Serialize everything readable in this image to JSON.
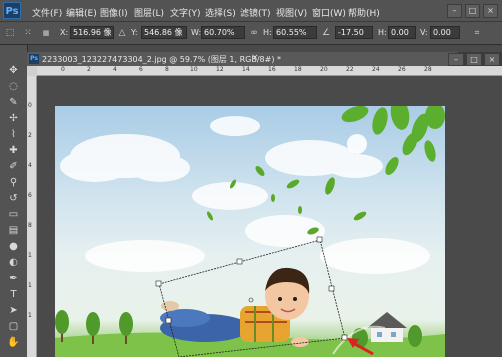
{
  "app": {
    "logo": "Ps"
  },
  "menu": {
    "items": [
      "文件(F)",
      "编辑(E)",
      "图像(I)",
      "图层(L)",
      "文字(Y)",
      "选择(S)",
      "滤镜(T)",
      "视图(V)",
      "窗口(W)",
      "帮助(H)"
    ]
  },
  "window_buttons": [
    "–",
    "□",
    "×"
  ],
  "options": {
    "x_label": "X:",
    "x_value": "516.96 像",
    "y_label": "Y:",
    "y_value": "546.86 像",
    "w_label": "W:",
    "w_value": "60.70%",
    "h_label": "H:",
    "h_value": "60.55%",
    "angle_value": "-17.50",
    "hskew_label": "H:",
    "hskew_value": "0.00",
    "vskew_label": "V:",
    "vskew_value": "0.00"
  },
  "document": {
    "tab_title": "2233003_123227473304_2.jpg @ 59.7% (图层 1, RGB/8#) *",
    "close": "×"
  },
  "ruler": {
    "h_ticks": [
      "0",
      "2",
      "4",
      "6",
      "8",
      "10",
      "12",
      "14",
      "16",
      "18",
      "20",
      "22",
      "24",
      "26",
      "28"
    ],
    "v_ticks": [
      "0",
      "2",
      "4",
      "6",
      "8",
      "1",
      "1",
      "1"
    ]
  },
  "tools": [
    "move-icon",
    "lasso-icon",
    "quick-select-icon",
    "crop-icon",
    "eyedropper-icon",
    "healing-icon",
    "brush-icon",
    "clone-stamp-icon",
    "history-brush-icon",
    "eraser-icon",
    "gradient-icon",
    "blur-icon",
    "dodge-icon",
    "pen-icon",
    "type-icon",
    "path-select-icon",
    "shape-icon"
  ]
}
